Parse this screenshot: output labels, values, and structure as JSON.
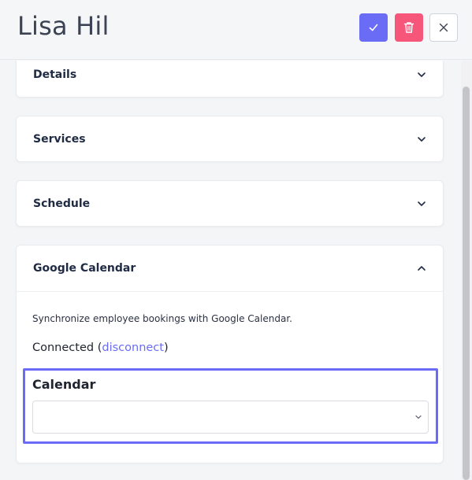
{
  "header": {
    "title": "Lisa Hil",
    "save_icon": "check-icon",
    "delete_icon": "trash-icon",
    "close_icon": "close-icon"
  },
  "sections": [
    {
      "title": "Details",
      "state": "collapsed"
    },
    {
      "title": "Services",
      "state": "collapsed"
    },
    {
      "title": "Schedule",
      "state": "collapsed"
    },
    {
      "title": "Google Calendar",
      "state": "expanded"
    }
  ],
  "google_calendar": {
    "description": "Synchronize employee bookings with Google Calendar.",
    "status_text": "Connected",
    "disconnect_link": "disconnect",
    "calendar_label": "Calendar",
    "calendar_value": ""
  },
  "colors": {
    "accent": "#6a6cf6",
    "danger": "#f5567a"
  }
}
